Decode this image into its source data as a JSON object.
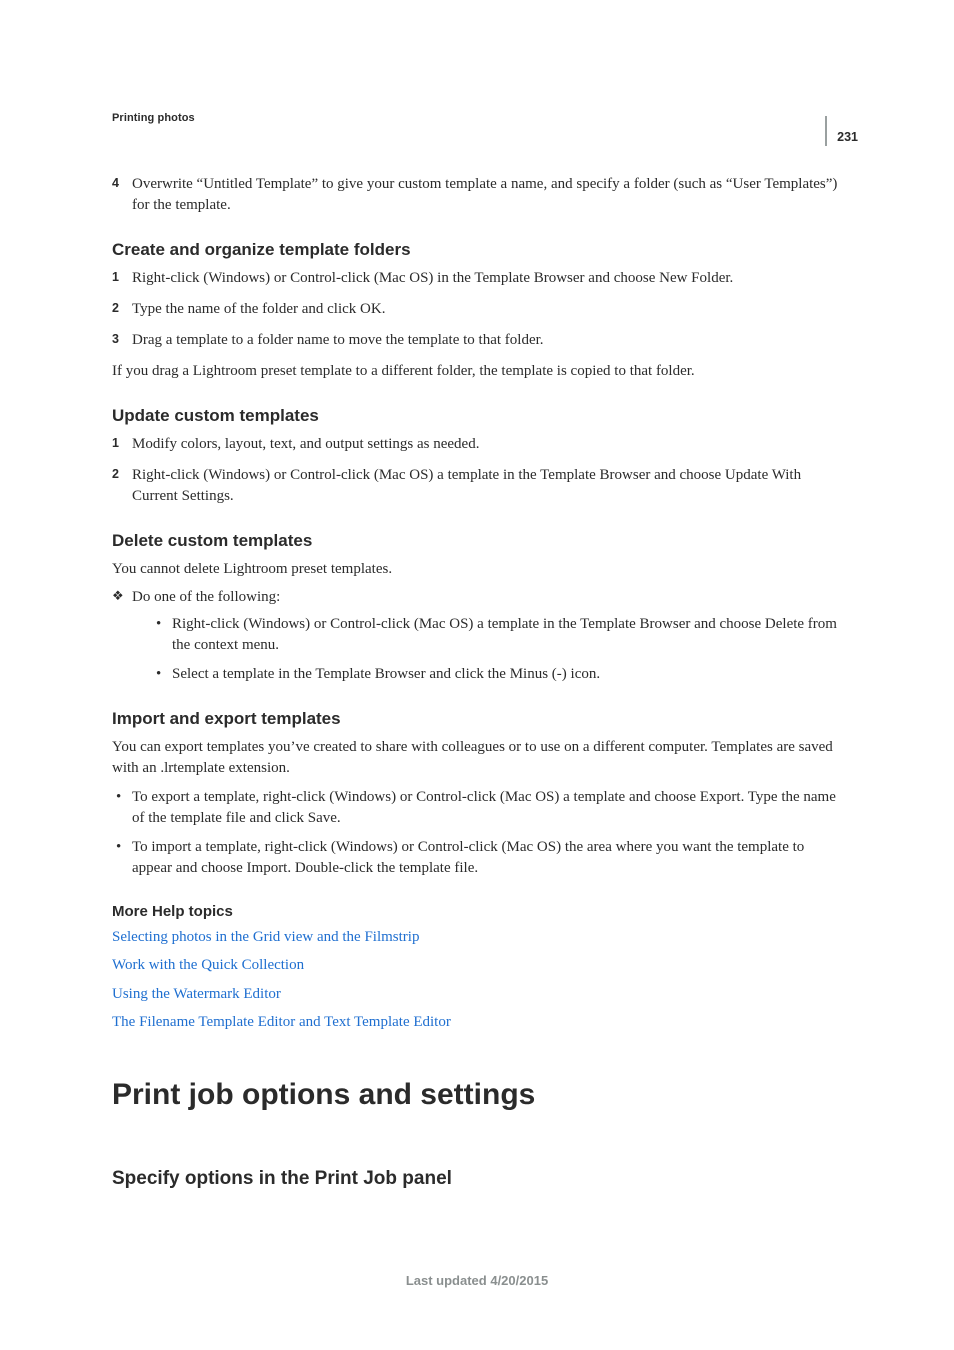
{
  "pageNumber": "231",
  "runningHead": "Printing photos",
  "step4": "Overwrite “Untitled Template” to give your custom template a name, and specify a folder (such as “User Templates”) for the template.",
  "sections": {
    "createOrganize": {
      "heading": "Create and organize template folders",
      "step1": "Right-click (Windows) or Control-click (Mac OS) in the Template Browser and choose New Folder.",
      "step2": "Type the name of the folder and click OK.",
      "step3": "Drag a template to a folder name to move the template to that folder.",
      "trailing": "If you drag a Lightroom preset template to a different folder, the template is copied to that folder."
    },
    "update": {
      "heading": "Update custom templates",
      "step1": "Modify colors, layout, text, and output settings as needed.",
      "step2": "Right-click (Windows) or Control-click (Mac OS) a template in the Template Browser and choose Update With Current Settings."
    },
    "delete": {
      "heading": "Delete custom templates",
      "intro": "You cannot delete Lightroom preset templates.",
      "lead": "Do one of the following:",
      "sub1": "Right-click (Windows) or Control-click (Mac OS) a template in the Template Browser and choose Delete from the context menu.",
      "sub2": "Select a template in the Template Browser and click the Minus (-) icon."
    },
    "importExport": {
      "heading": "Import and export templates",
      "intro": "You can export templates you’ve created to share with colleagues or to use on a different computer. Templates are saved with an .lrtemplate extension.",
      "b1": "To export a template, right-click (Windows) or Control-click (Mac OS) a template and choose Export. Type the name of the template file and click Save.",
      "b2": "To import a template, right-click (Windows) or Control-click (Mac OS) the area where you want the template to appear and choose Import. Double-click the template file."
    },
    "moreHelp": {
      "heading": "More Help topics",
      "links": {
        "l1": "Selecting photos in the Grid view and the Filmstrip",
        "l2": "Work with the Quick Collection",
        "l3": "Using the Watermark Editor",
        "l4": "The Filename Template Editor and Text Template Editor"
      }
    }
  },
  "chapter": {
    "title": "Print job options and settings",
    "subsection": "Specify options in the Print Job panel"
  },
  "stepNums": {
    "n1": "1",
    "n2": "2",
    "n3": "3",
    "n4": "4"
  },
  "footer": "Last updated 4/20/2015"
}
